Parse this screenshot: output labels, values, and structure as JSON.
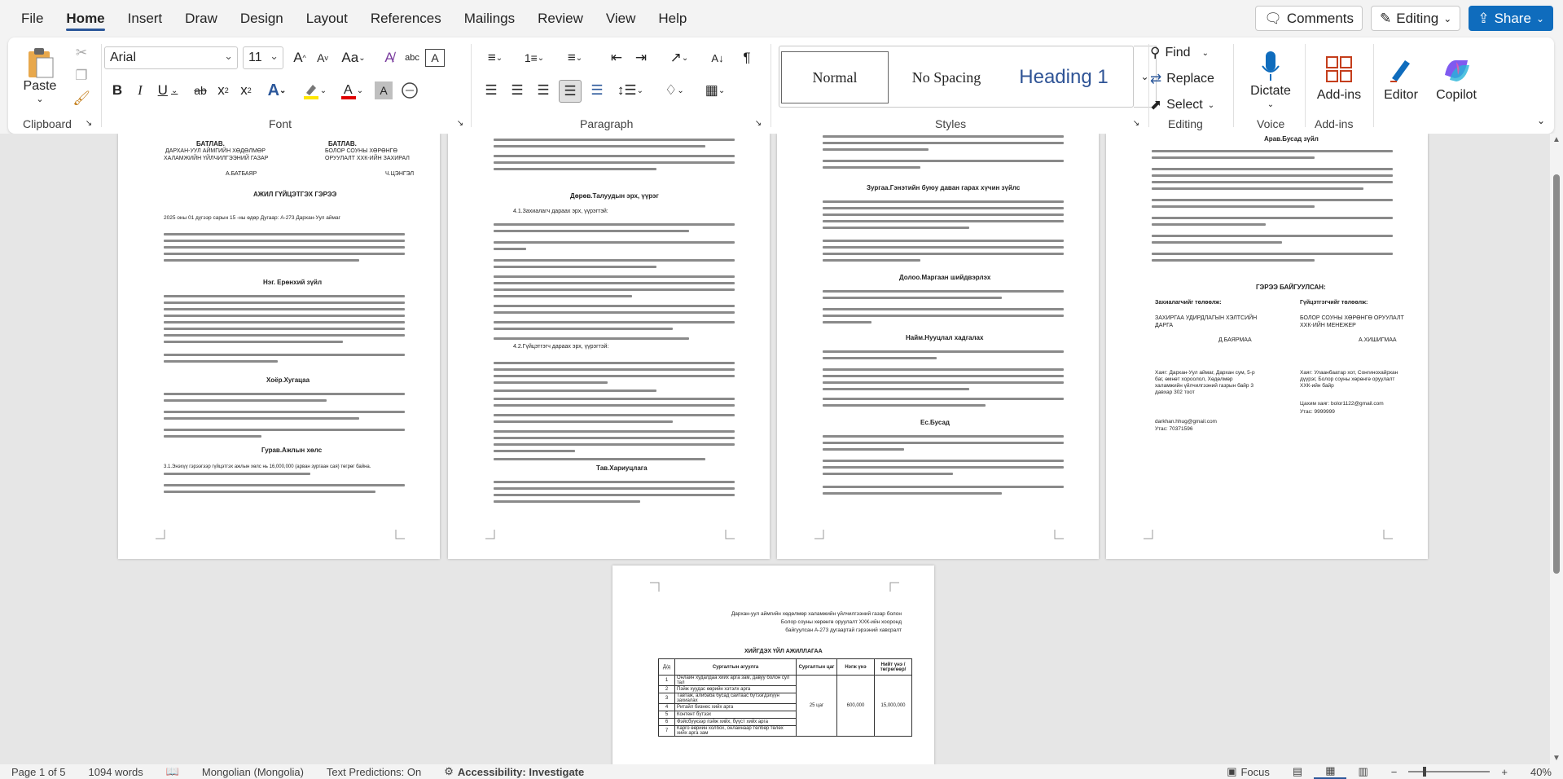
{
  "menu": {
    "items": [
      "File",
      "Home",
      "Insert",
      "Draw",
      "Design",
      "Layout",
      "References",
      "Mailings",
      "Review",
      "View",
      "Help"
    ],
    "active": "Home",
    "comments_label": "Comments",
    "editing_label": "Editing",
    "share_label": "Share"
  },
  "ribbon": {
    "clipboard": {
      "paste_label": "Paste",
      "group_label": "Clipboard"
    },
    "font": {
      "font_name": "Arial",
      "font_size": "11",
      "group_label": "Font",
      "change_case": "Aa"
    },
    "paragraph": {
      "group_label": "Paragraph"
    },
    "styles": {
      "normal": "Normal",
      "no_spacing": "No Spacing",
      "heading1": "Heading 1",
      "group_label": "Styles"
    },
    "editing": {
      "find": "Find",
      "replace": "Replace",
      "select": "Select",
      "group_label": "Editing"
    },
    "voice": {
      "dictate": "Dictate",
      "group_label": "Voice"
    },
    "addins": {
      "addins": "Add-ins",
      "group_label": "Add-ins"
    },
    "editor": {
      "label": "Editor"
    },
    "copilot": {
      "label": "Copilot"
    }
  },
  "document": {
    "page1": {
      "approve_left": "БАТЛАВ.",
      "approve_right": "БАТЛАВ.",
      "org_left_1": "ДАРХАН-УУЛ АЙМГИЙН ХӨДӨЛМӨР",
      "org_left_2": "ХАЛАМЖИЙН ҮЙЛЧИЛГЭЭНИЙ ГАЗАР",
      "org_right_1": "БОЛОР СОУНЫ ХӨРӨНГӨ",
      "org_right_2": "ОРУУЛАЛТ ХХК-ИЙН ЗАХИРАЛ",
      "sign_left": "А.БАТБАЯР",
      "sign_right": "Ч.ЦЭНГЭЛ",
      "title": "АЖИЛ ГҮЙЦЭТГЭХ ГЭРЭЭ",
      "date_line": "2025 оны 01 дүгээр сарын 15 -ны өдөр        Дугаар: А-273              Дархан-Уул аймаг",
      "section1": "Нэг. Ерөнхий зүйл",
      "section2": "Хоёр.Хугацаа",
      "section3": "Гурав.Ажлын хөлс",
      "amount": "3.1.Энэхүү гэрээгээр гүйцэтгэх ажлын хөлс нь 16,000,000 (арван зургаан сая) төгрөг байна."
    },
    "page2": {
      "section4": "Дөрөв.Талуудын эрх, үүрэг",
      "sub1": "4.1.Захиалагч дараах эрх, үүрэгтэй:",
      "sub2": "4.2.Гүйцэтгэгч дараах эрх, үүрэгтэй:",
      "section6": "Тав.Хариуцлага"
    },
    "page3": {
      "section_force": "Зургаа.Гэнэтийн буюу даван гарах хүчин зүйлс",
      "section7": "Долоо.Маргаан шийдвэрлэх",
      "section8": "Найм.Нууцлал хадгалах",
      "section9": "Ес.Бусад"
    },
    "page4": {
      "section10": "Арав.Бусад зүйл",
      "signatures": "ГЭРЭЭ БАЙГУУЛСАН:",
      "client": "Захиалагчийг төлөөлж:",
      "contractor": "Гүйцэтгэгчийг төлөөлж:",
      "client_org": "ЗАХИРГАА УДИРДЛАГЫН ХЭЛТСИЙН ДАРГА",
      "contractor_org": "БОЛОР СОУНЫ ХӨРӨНГӨ ОРУУЛАЛТ ХХК-ИЙН МЕНЕЖЕР",
      "client_name": "Д.БАЯРМАА",
      "contractor_name": "А.ХИШИГМАА",
      "client_addr": "Хаяг: Дархан-Уул аймаг, Дархан сум, 5-р баг, өмнөт хороолол, Хөдөлмөр халамжийн үйлчилгээний газрын байр 3 давхар 302 тоот",
      "client_email": "darkhan.hhug@gmail.com",
      "client_phone": "Утас: 70371596",
      "contractor_addr": "Хаяг: Улаанбаатар хот, Сонгинохайрхан дүүрэг, Болор соуны хөрөнгө оруулалт ХХК-ийн байр",
      "contractor_email": "Цахим хаяг: bolor1122@gmail.com",
      "contractor_phone": "Утас: 9999999"
    },
    "page5": {
      "header_1": "Дархан-уул аймгийн хөдөлмөр халамжийн үйлчилгээний газар болон",
      "header_2": "Болор соуны хөрөнгө оруулалт ХХК-ийн хооронд",
      "header_3": "байгуулсан А-273 дугаартай гэрээний хавсралт",
      "table_title": "ХИЙГДЭХ ҮЙЛ АЖИЛЛАГАА",
      "col_no": "Д/д",
      "col_method": "Сургалтын агуулга",
      "col_duration": "Сургалтын цаг",
      "col_price": "Нэгж үнэ",
      "col_total": "Нийт үнэ /төгрөгөөр/",
      "rows": [
        {
          "no": "1",
          "text": "Онлайн худалдаа хийх арга зам, давуу болон сул тал"
        },
        {
          "no": "2",
          "text": "Пэйж хуудас өөрийн хэтэлх арга"
        },
        {
          "no": "3",
          "text": "Тавтаж, алибаба бусад сайтаас бүтээгдэхүүн захиалах"
        },
        {
          "no": "4",
          "text": "Ритайл бизнес хийх арга"
        },
        {
          "no": "5",
          "text": "Контент бүтээх"
        },
        {
          "no": "6",
          "text": "Фэйсбүүкээр пэйж хийх, бүүст хийх арга"
        },
        {
          "no": "7",
          "text": "Карго өөрийн холбох, онлайнаар төлбөр төлөх хийх арга зам"
        }
      ],
      "duration": "25 цаг",
      "price": "600,000",
      "total": "15,000,000"
    }
  },
  "status": {
    "page": "Page 1 of 5",
    "words": "1094 words",
    "language": "Mongolian (Mongolia)",
    "predictions": "Text Predictions: On",
    "accessibility": "Accessibility: Investigate",
    "focus": "Focus",
    "zoom": "40%"
  }
}
